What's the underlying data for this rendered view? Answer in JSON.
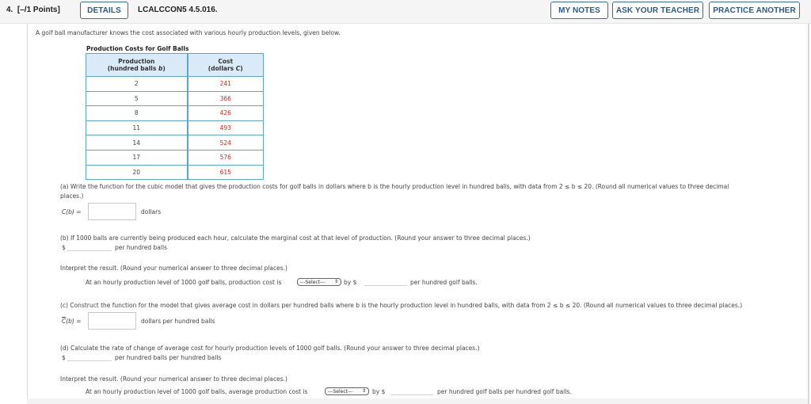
{
  "header": {
    "question_number": "4.",
    "points": "[–/1 Points]",
    "details_label": "DETAILS",
    "question_code": "LCALCCON5 4.5.016.",
    "my_notes_label": "MY NOTES",
    "ask_teacher_label": "ASK YOUR TEACHER",
    "practice_another_label": "PRACTICE ANOTHER"
  },
  "intro": "A golf ball manufacturer knows the cost associated with various hourly production levels, given below.",
  "table": {
    "title": "Production Costs for Golf Balls",
    "headers": [
      {
        "line1": "Production",
        "line2": "(hundred balls ",
        "var": "b",
        "end": ")"
      },
      {
        "line1": "Cost",
        "line2": "(dollars ",
        "var": "C",
        "end": ")"
      }
    ],
    "rows": [
      {
        "production": "2",
        "cost": "241"
      },
      {
        "production": "5",
        "cost": "366"
      },
      {
        "production": "8",
        "cost": "426"
      },
      {
        "production": "11",
        "cost": "493"
      },
      {
        "production": "14",
        "cost": "524"
      },
      {
        "production": "17",
        "cost": "576"
      },
      {
        "production": "20",
        "cost": "615"
      }
    ]
  },
  "part_a": {
    "prompt_line1": "(a) Write the function for the cubic model that gives the production costs for golf balls in dollars where b is the hourly production level in hundred balls, with data from  2 ≤ b ≤ 20.  (Round all numerical values to three decimal",
    "prompt_line2": "places.)",
    "label": "C(b)  =",
    "input_value": "",
    "unit": "dollars"
  },
  "part_b": {
    "prompt": "(b) If 1000 balls are currently being produced each hour, calculate the marginal cost at that level of production. (Round your answer to three decimal places.)",
    "currency": "$",
    "input_value": "",
    "unit": "per hundred balls",
    "interpret_prompt": "Interpret the result. (Round your numerical answer to three decimal places.)",
    "interpret_text": "At an hourly production level of 1000 golf balls, production cost is",
    "select_value": "---Select---",
    "by_label": "by $",
    "interpret_input_value": "",
    "interpret_unit": "per hundred golf balls."
  },
  "part_c": {
    "prompt": "(c) Construct the function for the model that gives average cost in dollars per hundred balls where b is the hourly production level in hundred balls, with data from  2 ≤ b ≤ 20.  (Round all numerical values to three decimal places.)",
    "label_c": "C",
    "label_rest": "(b)  =",
    "input_value": "",
    "unit": "dollars per hundred balls"
  },
  "part_d": {
    "prompt": "(d) Calculate the rate of change of average cost for hourly production levels of 1000 golf balls. (Round your answer to three decimal places.)",
    "currency": "$",
    "input_value": "",
    "unit": "per hundred balls per hundred balls",
    "interpret_prompt": "Interpret the result. (Round your numerical answer to three decimal places.)",
    "interpret_text": "At an hourly production level of 1000 golf balls, average production cost is",
    "select_value": "---Select---",
    "by_label": "by $",
    "interpret_input_value": "",
    "interpret_unit": "per hundred golf balls per hundred golf balls."
  }
}
